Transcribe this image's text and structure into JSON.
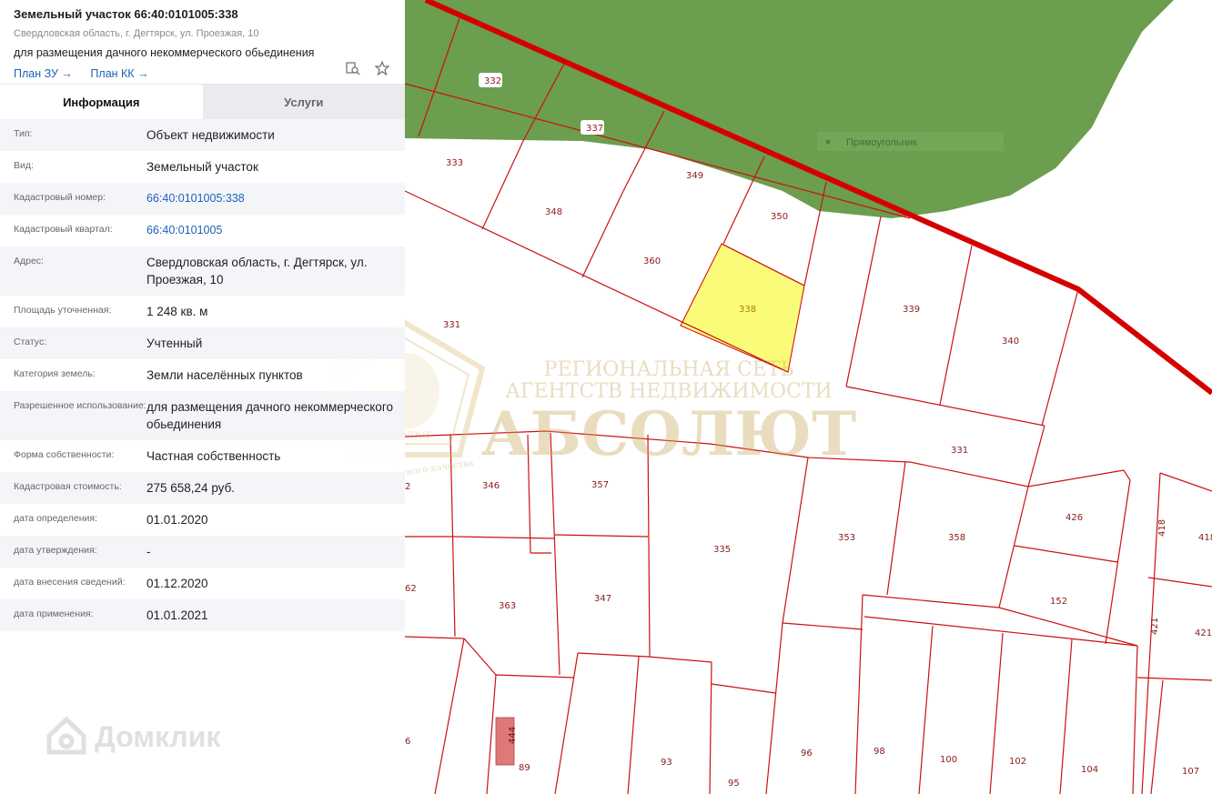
{
  "header": {
    "title": "Земельный участок 66:40:0101005:338",
    "address": "Свердловская область, г. Дегтярск, ул. Проезжая, 10",
    "purpose": "для размещения дачного некоммерческого обьединения",
    "links": [
      "План ЗУ →",
      "План КК →"
    ]
  },
  "tabs": [
    {
      "label": "Информация",
      "active": true
    },
    {
      "label": "Услуги",
      "active": false
    }
  ],
  "info_rows": [
    {
      "label": "Тип:",
      "value": "Объект недвижимости"
    },
    {
      "label": "Вид:",
      "value": "Земельный участок"
    },
    {
      "label": "Кадастровый номер:",
      "value": "66:40:0101005:338",
      "link": true
    },
    {
      "label": "Кадастровый квартал:",
      "value": "66:40:0101005",
      "link": true
    },
    {
      "label": "Адрес:",
      "value": "Свердловская область, г. Дегтярск, ул. Проезжая, 10"
    },
    {
      "label": "Площадь уточненная:",
      "value": "1 248 кв. м"
    },
    {
      "label": "Статус:",
      "value": "Учтенный"
    },
    {
      "label": "Категория земель:",
      "value": "Земли населённых пунктов"
    },
    {
      "label": "Разрешенное использование:",
      "value": "для размещения дачного некоммерческого обьединения"
    },
    {
      "label": "Форма собственности:",
      "value": "Частная собственность"
    },
    {
      "label": "Кадастровая стоимость:",
      "value": "275 658,24 руб."
    },
    {
      "label": "дата определения:",
      "value": "01.01.2020"
    },
    {
      "label": "дата утверждения:",
      "value": "-"
    },
    {
      "label": "дата внесения сведений:",
      "value": "01.12.2020"
    },
    {
      "label": "дата применения:",
      "value": "01.01.2021"
    }
  ],
  "map": {
    "tooltip": "Прямоугольник",
    "parcels": [
      "332",
      "337",
      "333",
      "349",
      "348",
      "350",
      "360",
      "338",
      "339",
      "340",
      "331",
      "331",
      "346",
      "357",
      "335",
      "353",
      "358",
      "426",
      "418",
      "418",
      "2",
      "363",
      "347",
      "152",
      "62",
      "421",
      "421",
      "6",
      "89",
      "93",
      "95",
      "96",
      "98",
      "100",
      "102",
      "104",
      "107",
      "444"
    ],
    "colors": {
      "forest": "#6b9e4e",
      "boundary": "#d40000",
      "selected": "#fbfb7a",
      "building": "#e07878"
    }
  },
  "watermarks": {
    "line1": "РЕГИОНАЛЬНАЯ СЕТЬ",
    "line2": "АГЕНТСТВ НЕДВИЖИМОСТИ",
    "brand": "АБСОЛЮТ",
    "seal_text": "АБСОЛЮТ",
    "arc_text": "Знак абсолютного качества",
    "domclick": "Домклик"
  }
}
